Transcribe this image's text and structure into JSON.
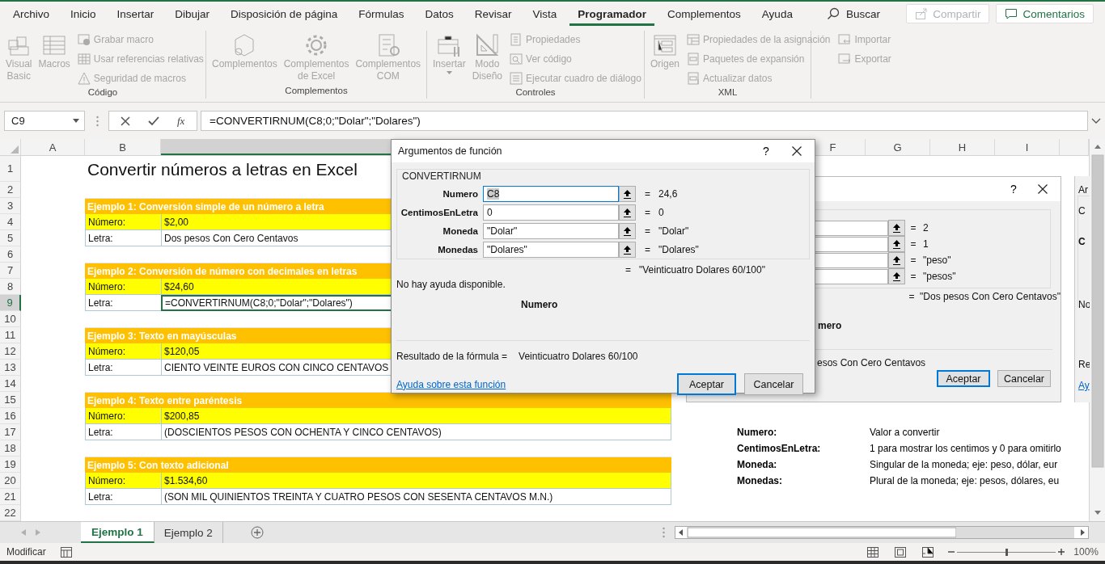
{
  "ribbon": {
    "tabs": [
      {
        "label": "Archivo",
        "selected": false
      },
      {
        "label": "Inicio",
        "selected": false
      },
      {
        "label": "Insertar",
        "selected": false
      },
      {
        "label": "Dibujar",
        "selected": false
      },
      {
        "label": "Disposición de página",
        "selected": false
      },
      {
        "label": "Fórmulas",
        "selected": false
      },
      {
        "label": "Datos",
        "selected": false
      },
      {
        "label": "Revisar",
        "selected": false
      },
      {
        "label": "Vista",
        "selected": false
      },
      {
        "label": "Programador",
        "selected": true
      },
      {
        "label": "Complementos",
        "selected": false
      },
      {
        "label": "Ayuda",
        "selected": false
      }
    ],
    "search": {
      "label": "Buscar"
    },
    "share_button": {
      "label": "Compartir",
      "disabled": true
    },
    "comments_button": {
      "label": "Comentarios"
    },
    "groups": [
      {
        "label": "Código",
        "commands": [
          {
            "kind": "large",
            "label": "Visual Basic",
            "disabled": true
          },
          {
            "kind": "large",
            "label": "Macros",
            "disabled": true
          },
          {
            "kind": "small",
            "label": "Grabar macro",
            "disabled": true
          },
          {
            "kind": "small",
            "label": "Usar referencias relativas",
            "disabled": true
          },
          {
            "kind": "small",
            "label": "Seguridad de macros",
            "disabled": true
          }
        ]
      },
      {
        "label": "Complementos",
        "commands": [
          {
            "kind": "large",
            "label": "Complementos",
            "disabled": true
          },
          {
            "kind": "large",
            "label": "Complementos de Excel",
            "disabled": true
          },
          {
            "kind": "large",
            "label": "Complementos COM",
            "disabled": true
          }
        ]
      },
      {
        "label": "Controles",
        "commands": [
          {
            "kind": "dropdown",
            "label": "Insertar",
            "disabled": true
          },
          {
            "kind": "large",
            "label": "Modo Diseño",
            "disabled": true
          },
          {
            "kind": "small",
            "label": "Propiedades",
            "disabled": true
          },
          {
            "kind": "small",
            "label": "Ver código",
            "disabled": true
          },
          {
            "kind": "small",
            "label": "Ejecutar cuadro de diálogo",
            "disabled": true
          }
        ]
      },
      {
        "label": "XML",
        "commands": [
          {
            "kind": "large",
            "label": "Origen",
            "disabled": true
          },
          {
            "kind": "small",
            "label": "Propiedades de la asignación",
            "disabled": true
          },
          {
            "kind": "small",
            "label": "Paquetes de expansión",
            "disabled": true
          },
          {
            "kind": "small",
            "label": "Actualizar datos",
            "disabled": true
          },
          {
            "kind": "small",
            "label": "Importar",
            "disabled": true
          },
          {
            "kind": "small",
            "label": "Exportar",
            "disabled": true
          }
        ]
      }
    ]
  },
  "formula_bar": {
    "name_box": "C9",
    "function_button": "fx",
    "formula": "=CONVERTIRNUM(C8;0;\"Dolar\";\"Dolares\")"
  },
  "columns": [
    {
      "label": "A",
      "selected": false
    },
    {
      "label": "B",
      "selected": false
    },
    {
      "selected": true
    },
    {
      "label": "F",
      "selected": false
    },
    {
      "label": "G",
      "selected": false
    },
    {
      "label": "H",
      "selected": false
    },
    {
      "label": "I",
      "selected": false
    },
    {
      "selected": false
    }
  ],
  "rows": [
    {
      "number": "1",
      "selected": false,
      "kind": "title",
      "text": "Convertir números a letras en Excel"
    },
    {
      "number": "2",
      "selected": false,
      "kind": "blank"
    },
    {
      "number": "3",
      "selected": false,
      "kind": "header",
      "text": "Ejemplo 1: Conversión simple de un número a letra"
    },
    {
      "number": "4",
      "selected": false,
      "kind": "value",
      "label": "Número:",
      "value": "$2,00",
      "highlight": true
    },
    {
      "number": "5",
      "selected": false,
      "kind": "value",
      "label": "Letra:",
      "value": "Dos pesos Con Cero Centavos",
      "highlight": false
    },
    {
      "number": "6",
      "selected": false,
      "kind": "blank"
    },
    {
      "number": "7",
      "selected": false,
      "kind": "header",
      "text": "Ejemplo 2: Conversión de número con decimales en letras"
    },
    {
      "number": "8",
      "selected": false,
      "kind": "value",
      "label": "Número:",
      "value": "$24,60",
      "highlight": true
    },
    {
      "number": "9",
      "selected": true,
      "kind": "value",
      "label": "Letra:",
      "value": "=CONVERTIRNUM(C8;0;\"Dolar\";\"Dolares\")",
      "highlight": false
    },
    {
      "number": "10",
      "selected": false,
      "kind": "blank"
    },
    {
      "number": "11",
      "selected": false,
      "kind": "header",
      "text": "Ejemplo 3: Texto en mayúsculas"
    },
    {
      "number": "12",
      "selected": false,
      "kind": "value",
      "label": "Número:",
      "value": "$120,05",
      "highlight": true
    },
    {
      "number": "13",
      "selected": false,
      "kind": "value",
      "label": "Letra:",
      "value": "CIENTO VEINTE EUROS CON CINCO CENTAVOS",
      "highlight": false
    },
    {
      "number": "14",
      "selected": false,
      "kind": "blank"
    },
    {
      "number": "15",
      "selected": false,
      "kind": "header",
      "text": "Ejemplo 4: Texto entre paréntesis"
    },
    {
      "number": "16",
      "selected": false,
      "kind": "value",
      "label": "Número:",
      "value": "$200,85",
      "highlight": true
    },
    {
      "number": "17",
      "selected": false,
      "kind": "value",
      "label": "Letra:",
      "value": "(DOSCIENTOS PESOS CON OCHENTA Y CINCO CENTAVOS)",
      "highlight": false,
      "note": {
        "term": "Numero:",
        "description": "Valor a convertir"
      }
    },
    {
      "number": "18",
      "selected": false,
      "kind": "blank",
      "note": {
        "term": "CentimosEnLetra:",
        "description": "1 para mostrar los centimos y 0 para omitirlo"
      }
    },
    {
      "number": "19",
      "selected": false,
      "kind": "header",
      "text": "Ejemplo 5: Con texto adicional",
      "note": {
        "term": "Moneda:",
        "description": "Singular de la moneda; eje: peso, dólar, eur"
      }
    },
    {
      "number": "20",
      "selected": false,
      "kind": "value",
      "label": "Número:",
      "value": "$1.534,60",
      "highlight": true,
      "note": {
        "term": "Monedas:",
        "description": "Plural de la moneda; eje: pesos, dólares, eu"
      }
    },
    {
      "number": "21",
      "selected": false,
      "kind": "value",
      "label": "Letra:",
      "value": "(SON MIL QUINIENTOS TREINTA Y CUATRO PESOS CON SESENTA CENTAVOS M.N.)",
      "highlight": false
    },
    {
      "number": "22",
      "selected": false,
      "kind": "blank"
    }
  ],
  "dialog": {
    "title": "Argumentos de función",
    "help": "?",
    "function_name": "CONVERTIRNUM",
    "arguments": [
      {
        "name": "Numero",
        "value": "C8",
        "result": "24,6",
        "selected": true
      },
      {
        "name": "CentimosEnLetra",
        "value": "0",
        "result": "0",
        "selected": false
      },
      {
        "name": "Moneda",
        "value": "\"Dolar\"",
        "result": "\"Dolar\"",
        "selected": false
      },
      {
        "name": "Monedas",
        "value": "\"Dolares\"",
        "result": "\"Dolares\"",
        "selected": false
      }
    ],
    "equals": "=",
    "result": "\"Veinticuatro Dolares 60/100\"",
    "description": "No hay ayuda disponible.",
    "argument_help": "Numero",
    "formula_result_label": "Resultado de la fórmula =",
    "formula_result": "Veinticuatro Dolares 60/100",
    "help_link": "Ayuda sobre esta función",
    "ok_button": "Aceptar",
    "cancel_button": "Cancelar"
  },
  "background_dialog": {
    "help": "?",
    "argument_results": [
      "2",
      "1",
      "\"peso\"",
      "\"pesos\""
    ],
    "equals": "=",
    "result": "\"Dos pesos Con Cero Centavos\"",
    "argument_help": "mero",
    "formula_result": "esos Con Cero Centavos",
    "ok_button": "Aceptar",
    "cancel_button": "Cancelar"
  },
  "edge_dialog": {
    "texts": [
      "Ar",
      "C",
      "C",
      "No",
      "Re",
      "Ay"
    ]
  },
  "sheet_tabs": [
    {
      "label": "Ejemplo 1",
      "selected": true
    },
    {
      "label": "Ejemplo 2",
      "selected": false
    }
  ],
  "status_bar": {
    "mode": "Modificar",
    "zoom": {
      "level": 0.5,
      "reading": "100%"
    }
  }
}
